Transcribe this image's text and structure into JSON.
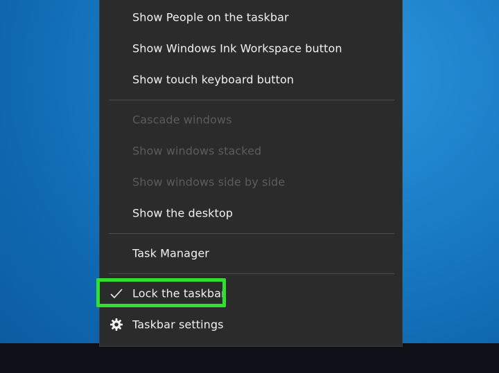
{
  "context_menu": {
    "items": [
      {
        "label": "Show People on the taskbar",
        "enabled": true
      },
      {
        "label": "Show Windows Ink Workspace button",
        "enabled": true
      },
      {
        "label": "Show touch keyboard button",
        "enabled": true
      },
      {
        "label": "Cascade windows",
        "enabled": false
      },
      {
        "label": "Show windows stacked",
        "enabled": false
      },
      {
        "label": "Show windows side by side",
        "enabled": false
      },
      {
        "label": "Show the desktop",
        "enabled": true
      },
      {
        "label": "Task Manager",
        "enabled": true
      },
      {
        "label": "Lock the taskbar",
        "enabled": true,
        "checked": true,
        "icon": "checkmark-icon"
      },
      {
        "label": "Taskbar settings",
        "enabled": true,
        "icon": "gear-icon"
      }
    ]
  },
  "colors": {
    "highlight": "#2fe033",
    "menu_background": "#2b2b2b",
    "desktop_accent": "#1b7fc8"
  }
}
